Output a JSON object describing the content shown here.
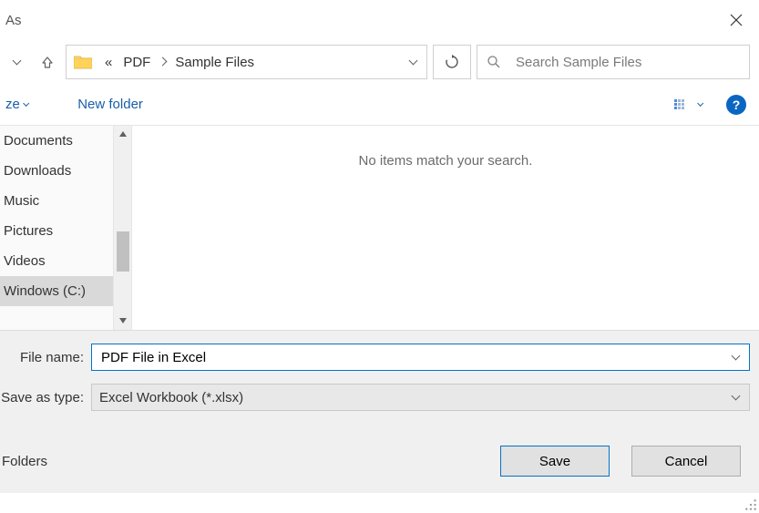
{
  "titlebar": {
    "title": "As"
  },
  "nav": {
    "breadcrumb_prefix": "«",
    "crumbs": [
      "PDF",
      "Sample Files"
    ]
  },
  "search": {
    "placeholder": "Search Sample Files"
  },
  "toolbar": {
    "organize_label": "ze",
    "newfolder_label": "New folder",
    "help_label": "?"
  },
  "sidebar": {
    "items": [
      {
        "label": "Documents"
      },
      {
        "label": "Downloads"
      },
      {
        "label": "Music"
      },
      {
        "label": "Pictures"
      },
      {
        "label": "Videos"
      },
      {
        "label": "Windows (C:)",
        "selected": true
      }
    ]
  },
  "main": {
    "empty_message": "No items match your search."
  },
  "footer": {
    "filename_label": "File name:",
    "filetype_label": "Save as type:",
    "filename_value": "PDF File in Excel",
    "filetype_value": "Excel Workbook (*.xlsx)",
    "folders_label": "Folders",
    "save_label": "Save",
    "cancel_label": "Cancel"
  }
}
